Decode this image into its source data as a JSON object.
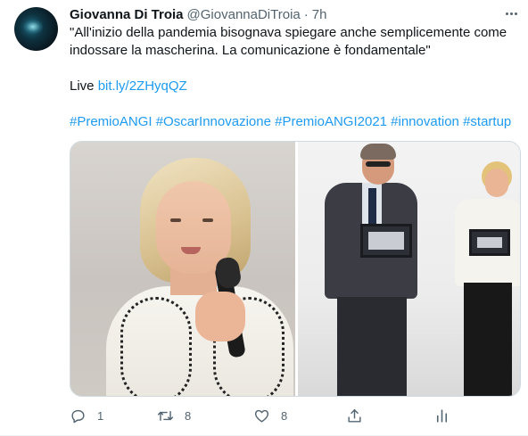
{
  "tweet": {
    "author_name": "Giovanna Di Troia",
    "author_handle": "@GiovannaDiTroia",
    "separator": "·",
    "time": "7h",
    "text_line_1": "\"All'inizio della pandemia bisognava spiegare anche semplicemente come",
    "text_line_2": "indossare la mascherina. La comunicazione è fondamentale\"",
    "live_label": "Live",
    "live_link": "bit.ly/2ZHyqQZ",
    "hashtags": "#PremioANGI #OscarInnovazione #PremioANGI2021 #innovation #startup"
  },
  "actions": {
    "reply_count": "1",
    "retweet_count": "8",
    "like_count": "8"
  },
  "icons": {
    "more": "more-horizontal-icon",
    "reply": "reply-icon",
    "retweet": "retweet-icon",
    "like": "heart-icon",
    "share": "share-icon",
    "analytics": "analytics-icon"
  },
  "colors": {
    "link": "#1d9bf0",
    "secondary_text": "#536471",
    "primary_text": "#0f1419"
  }
}
